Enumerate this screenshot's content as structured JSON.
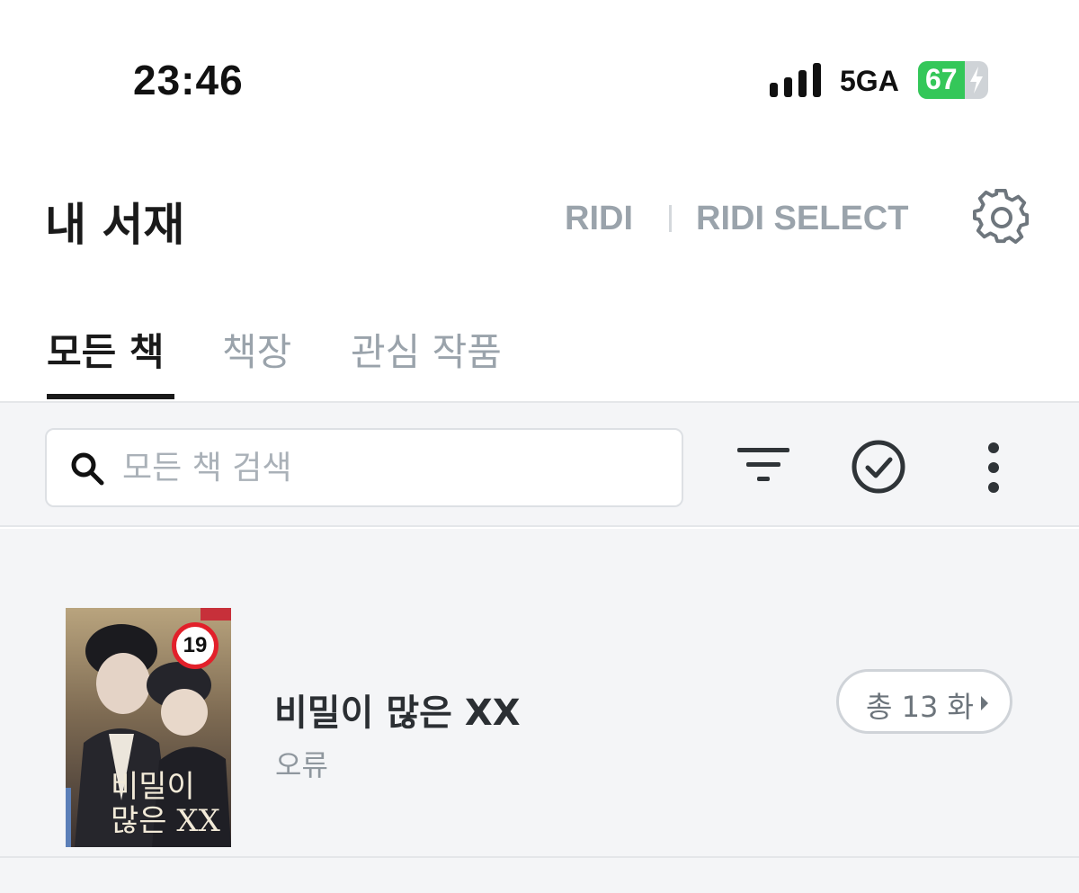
{
  "status_bar": {
    "time": "23:46",
    "network": "5GA",
    "battery": "67",
    "battery_level": 0.67,
    "battery_color": "#34c759"
  },
  "header": {
    "title": "내 서재",
    "brand_ridi": "RIDI",
    "brand_select": "RIDI SELECT",
    "settings_icon": "gear-icon"
  },
  "tabs": [
    {
      "label": "모든 책",
      "active": true
    },
    {
      "label": "책장",
      "active": false
    },
    {
      "label": "관심 작품",
      "active": false
    }
  ],
  "toolbar": {
    "search_placeholder": "모든 책 검색",
    "search_icon": "search-icon",
    "filter_icon": "filter-icon",
    "select_icon": "check-circle-icon",
    "more_icon": "more-vertical-icon"
  },
  "books": [
    {
      "title": "비밀이 많은 XX",
      "author": "오류",
      "episodes": "총 13 화",
      "cover": {
        "age_rating": "19",
        "title": "비밀이 많은 XX"
      }
    }
  ]
}
